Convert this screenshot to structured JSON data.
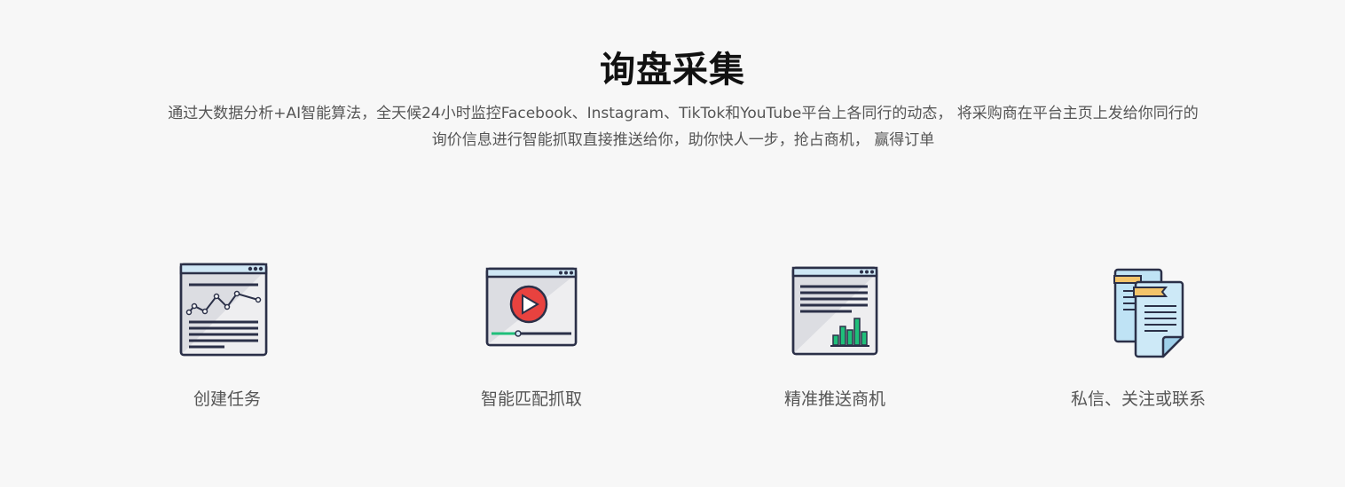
{
  "section": {
    "title": "询盘采集",
    "description_line1": "通过大数据分析+AI智能算法，全天候24小时监控Facebook、Instagram、TikTok和YouTube平台上各同行的动态， 将采购商在平台主页上发给你同行的",
    "description_line2": "询价信息进行智能抓取直接推送给你，助你快人一步，抢占商机， 赢得订单"
  },
  "features": [
    {
      "label": "创建任务",
      "icon": "chart-window-icon"
    },
    {
      "label": "智能匹配抓取",
      "icon": "video-window-icon"
    },
    {
      "label": "精准推送商机",
      "icon": "bar-chart-window-icon"
    },
    {
      "label": "私信、关注或联系",
      "icon": "documents-icon"
    }
  ],
  "colors": {
    "outline": "#2b3048",
    "window_fill": "#dcdde2",
    "titlebar_fill": "#cfe7f5",
    "play_red": "#e8423f",
    "bar_green": "#1fbf7a",
    "doc_blue": "#bfe3f5",
    "doc_tab": "#f3c46a"
  }
}
